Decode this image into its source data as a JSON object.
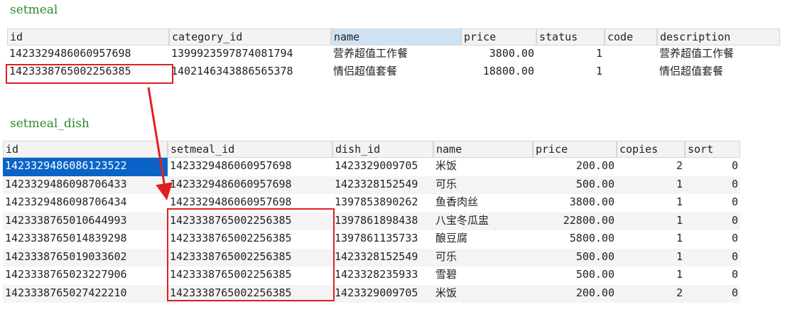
{
  "titles": {
    "setmeal": "setmeal",
    "setmeal_dish": "setmeal_dish"
  },
  "colors": {
    "title": "#2e8b2e",
    "annotation": "#e02020",
    "selected_cell": "#0a64c8",
    "header_selected": "#cfe3f5"
  },
  "setmeal": {
    "columns": [
      "id",
      "category_id",
      "name",
      "price",
      "status",
      "code",
      "description"
    ],
    "rows": [
      [
        "1423329486060957698",
        "1399923597874081794",
        "营养超值工作餐",
        "3800.00",
        "1",
        "",
        "营养超值工作餐"
      ],
      [
        "1423338765002256385",
        "1402146343886565378",
        "情侣超值套餐",
        "18800.00",
        "1",
        "",
        "情侣超值套餐"
      ]
    ]
  },
  "setmeal_dish": {
    "columns": [
      "id",
      "setmeal_id",
      "dish_id",
      "name",
      "price",
      "copies",
      "sort"
    ],
    "rows": [
      [
        "1423329486086123522",
        "1423329486060957698",
        "1423329009705",
        "米饭",
        "200.00",
        "2",
        "0"
      ],
      [
        "1423329486098706433",
        "1423329486060957698",
        "1423328152549",
        "可乐",
        "500.00",
        "1",
        "0"
      ],
      [
        "1423329486098706434",
        "1423329486060957698",
        "1397853890262",
        "鱼香肉丝",
        "3800.00",
        "1",
        "0"
      ],
      [
        "1423338765010644993",
        "1423338765002256385",
        "1397861898438",
        "八宝冬瓜盅",
        "22800.00",
        "1",
        "0"
      ],
      [
        "1423338765014839298",
        "1423338765002256385",
        "1397861135733",
        "酿豆腐",
        "5800.00",
        "1",
        "0"
      ],
      [
        "1423338765019033602",
        "1423338765002256385",
        "1423328152549",
        "可乐",
        "500.00",
        "1",
        "0"
      ],
      [
        "1423338765023227906",
        "1423338765002256385",
        "1423328235933",
        "雪碧",
        "500.00",
        "1",
        "0"
      ],
      [
        "1423338765027422210",
        "1423338765002256385",
        "1423329009705",
        "米饭",
        "200.00",
        "2",
        "0"
      ]
    ]
  }
}
